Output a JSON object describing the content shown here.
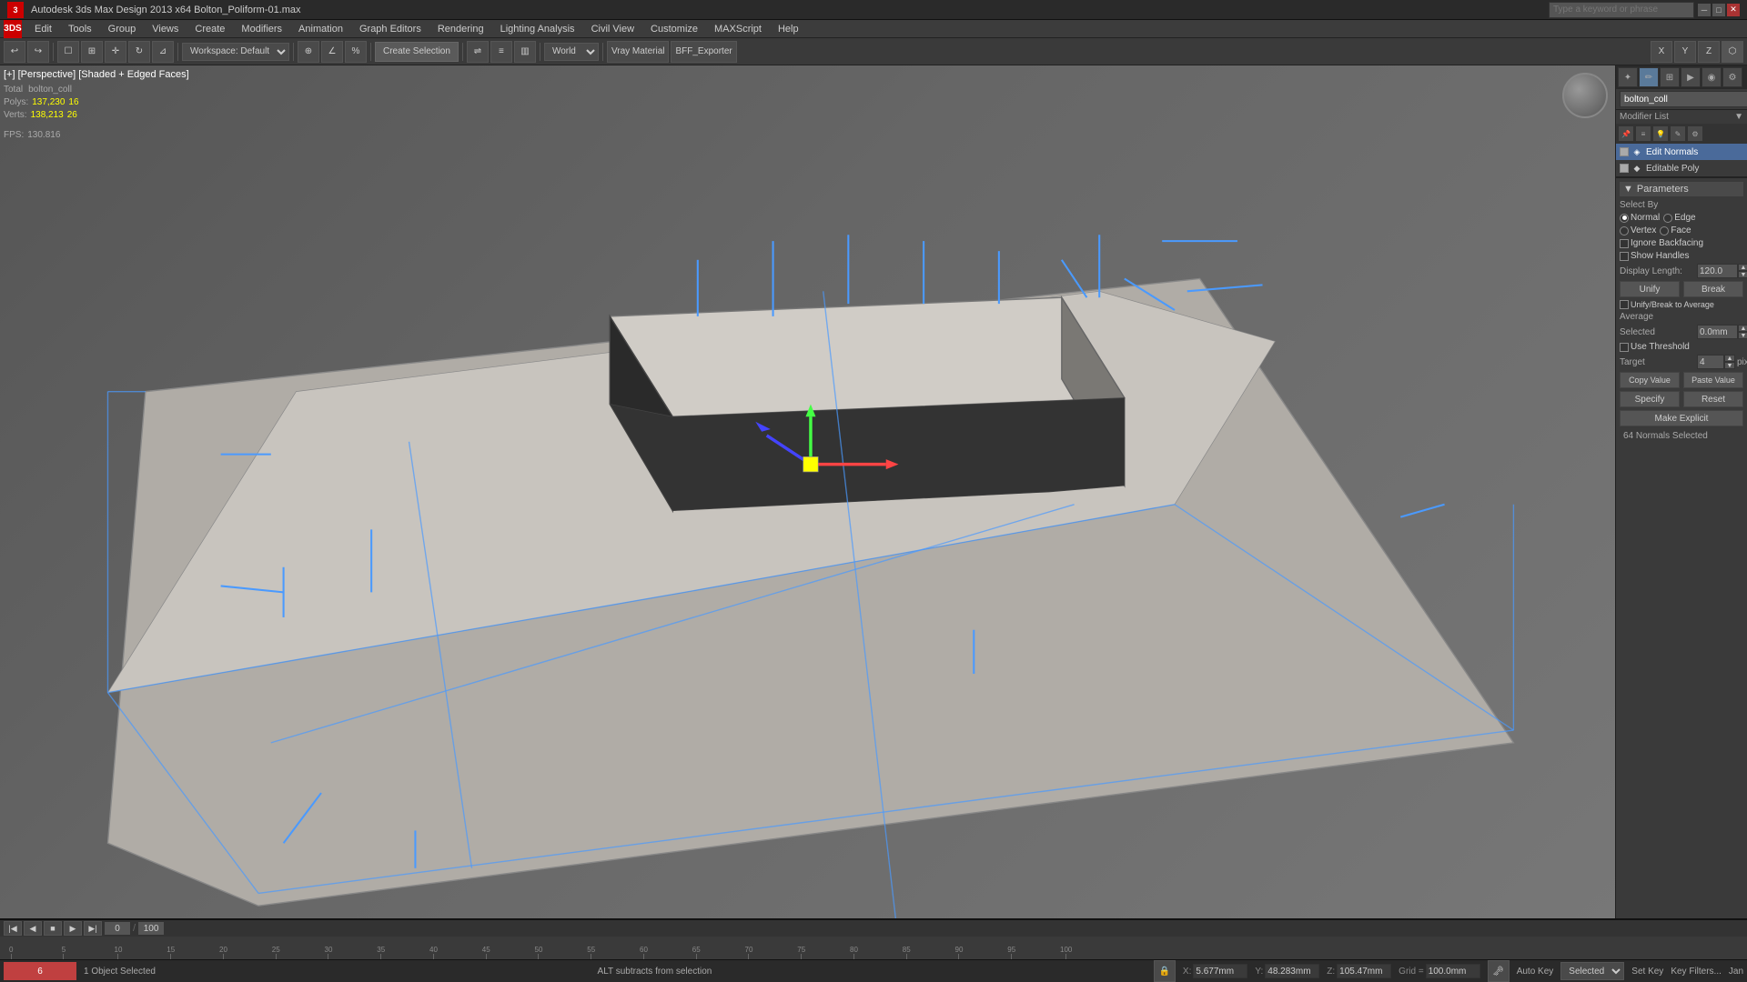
{
  "titlebar": {
    "title": "Autodesk 3ds Max Design 2013 x64    Bolton_Poliform-01.max",
    "search_placeholder": "Type a keyword or phrase"
  },
  "menubar": {
    "items": [
      "3DS",
      "Edit",
      "Tools",
      "Group",
      "Views",
      "Create",
      "Modifiers",
      "Animation",
      "Graph Editors",
      "Rendering",
      "Lighting Analysis",
      "Civil View",
      "Customize",
      "MAXScript",
      "Help"
    ]
  },
  "viewport": {
    "label": "[+] [Perspective] [Shaded + Edged Faces]",
    "stats": {
      "polys_label": "Polys:",
      "polys_total": "137,230",
      "polys_sel": "16",
      "verts_label": "Verts:",
      "verts_total": "138,213",
      "verts_sel": "26",
      "fps_label": "FPS:",
      "fps_val": "130.816",
      "total_label": "Total",
      "obj_label": "bolton_coll"
    }
  },
  "right_panel": {
    "obj_name": "bolton_coll",
    "modifier_list_label": "Modifier List",
    "modifiers": [
      {
        "name": "Edit Normals",
        "active": true
      },
      {
        "name": "Editable Poly",
        "active": false
      }
    ],
    "params_header": "Parameters",
    "select_by_label": "Select By",
    "normal_radio": "Normal",
    "edge_radio": "Edge",
    "vertex_radio": "Vertex",
    "face_radio": "Face",
    "ignore_backfacing": "Ignore Backfacing",
    "show_handles": "Show Handles",
    "display_length_label": "Display Length:",
    "display_length_val": "120.0",
    "unify_btn": "Unify",
    "break_btn": "Break",
    "unify_break_avg": "Unify/Break to Average",
    "average_label": "Average",
    "selected_label": "Selected",
    "selected_val": "0.0mm",
    "use_threshold": "Use Threshold",
    "target_label": "Target",
    "target_val": "4",
    "pixels_label": "pixels",
    "copy_value_btn": "Copy Value",
    "paste_value_btn": "Paste Value",
    "specify_btn": "Specify",
    "reset_btn": "Reset",
    "make_explicit_btn": "Make Explicit",
    "normals_selected": "64 Normals Selected"
  },
  "statusbar": {
    "objects_selected": "1 Object Selected",
    "hint": "ALT subtracts from selection",
    "x_label": "X:",
    "x_val": "5.677mm",
    "y_label": "Y:",
    "y_val": "48.283mm",
    "z_label": "Z:",
    "z_val": "105.47mm",
    "grid_label": "Grid =",
    "grid_val": "100.0mm",
    "auto_key": "Auto Key",
    "selected_label": "Selected",
    "set_key_label": "Set Key",
    "key_filters_label": "Key Filters...",
    "jan_label": "Jan",
    "frame_range": "0 / 100"
  },
  "toolbar": {
    "create_selection": "Create Selection",
    "workspace": "Workspace: Default",
    "vray_material": "Vray Material",
    "bff_exporter": "BFF_Exporter"
  },
  "timeline": {
    "frame_range": "0 / 100",
    "ticks": [
      0,
      5,
      10,
      15,
      20,
      25,
      30,
      35,
      40,
      45,
      50,
      55,
      60,
      65,
      70,
      75,
      80,
      85,
      90,
      95,
      100
    ]
  }
}
